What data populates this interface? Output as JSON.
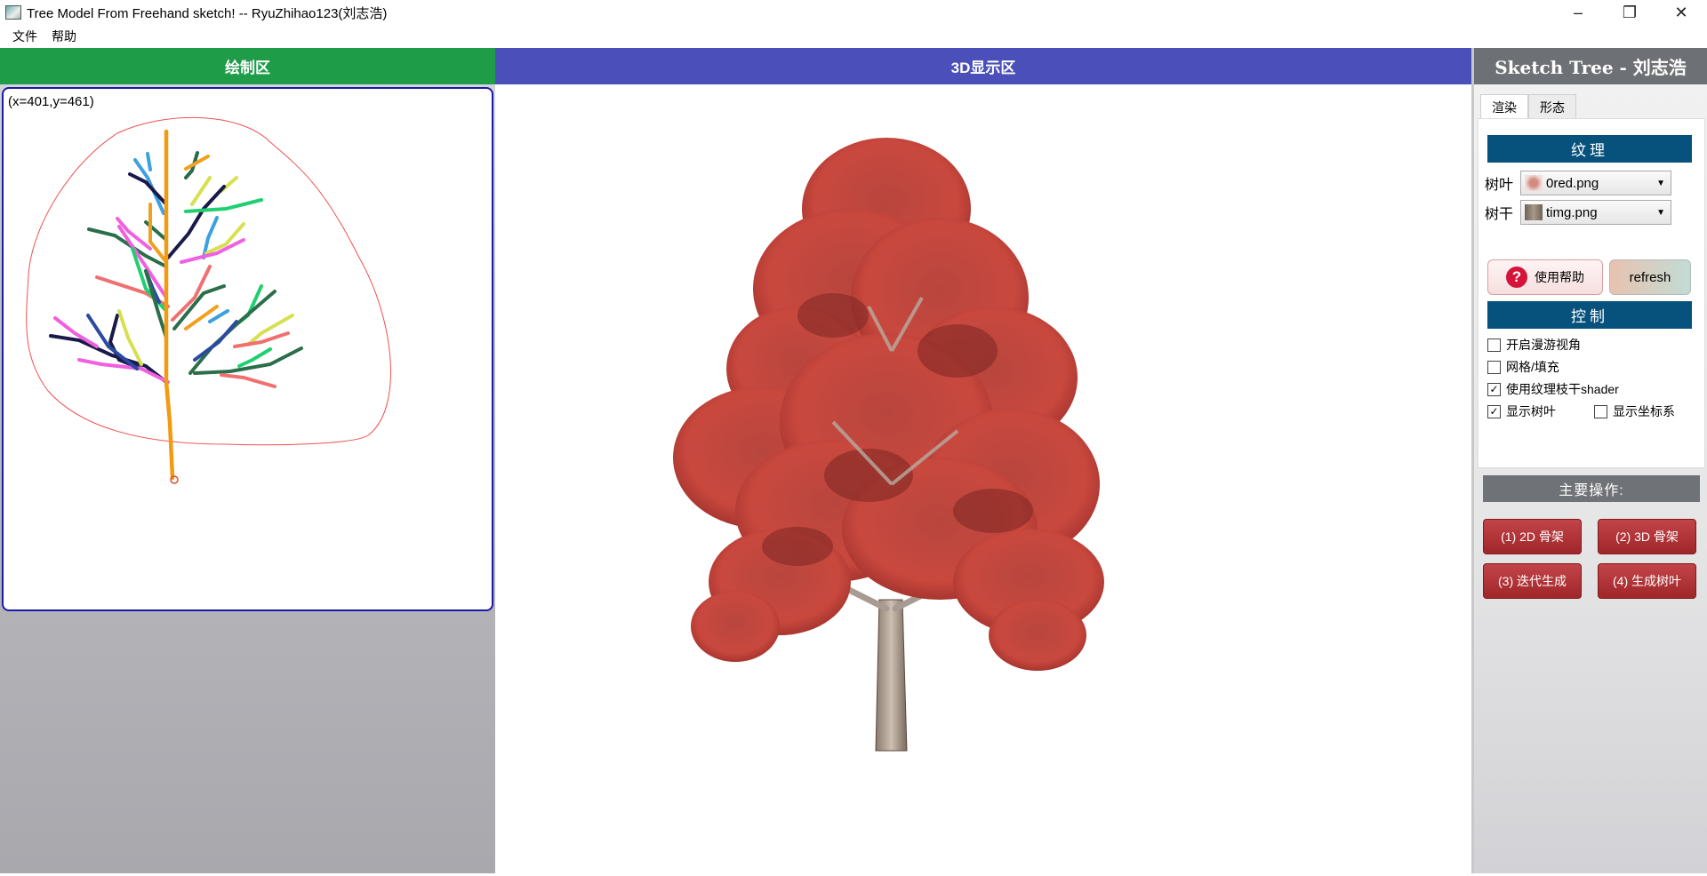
{
  "window": {
    "title": "Tree Model From Freehand sketch! -- RyuZhihao123(刘志浩)",
    "controls": [
      "minimize-icon",
      "restore-icon",
      "close-icon"
    ]
  },
  "menu": {
    "items": [
      "文件",
      "帮助"
    ]
  },
  "left_panel": {
    "header": "绘制区",
    "coords": "(x=401,y=461)"
  },
  "center_panel": {
    "header": "3D显示区"
  },
  "right_panel": {
    "brand": "Sketch Tree - 刘志浩",
    "tabs": [
      "渲染",
      "形态"
    ],
    "active_tab": "渲染",
    "texture_section": "纹理",
    "leaf_label": "树叶",
    "leaf_value": "0red.png",
    "trunk_label": "树干",
    "trunk_value": "timg.png",
    "help_button": "使用帮助",
    "refresh_button": "refresh",
    "control_section": "控制",
    "checkboxes": [
      {
        "label": "开启漫游视角",
        "checked": false
      },
      {
        "label": "网格/填充",
        "checked": false
      },
      {
        "label": "使用纹理枝干shader",
        "checked": true
      },
      {
        "label": "显示树叶",
        "checked": true
      },
      {
        "label": "显示坐标系",
        "checked": false
      }
    ],
    "ops_title": "主要操作:",
    "ops_buttons": [
      "(1) 2D 骨架",
      "(2) 3D 骨架",
      "(3) 迭代生成",
      "(4) 生成树叶"
    ]
  },
  "colors": {
    "draw_header": "#1e9c48",
    "view_header": "#4a4fb9",
    "section_bar": "#06527d",
    "op_button": "#b0343a",
    "foliage": "#c9483e"
  }
}
